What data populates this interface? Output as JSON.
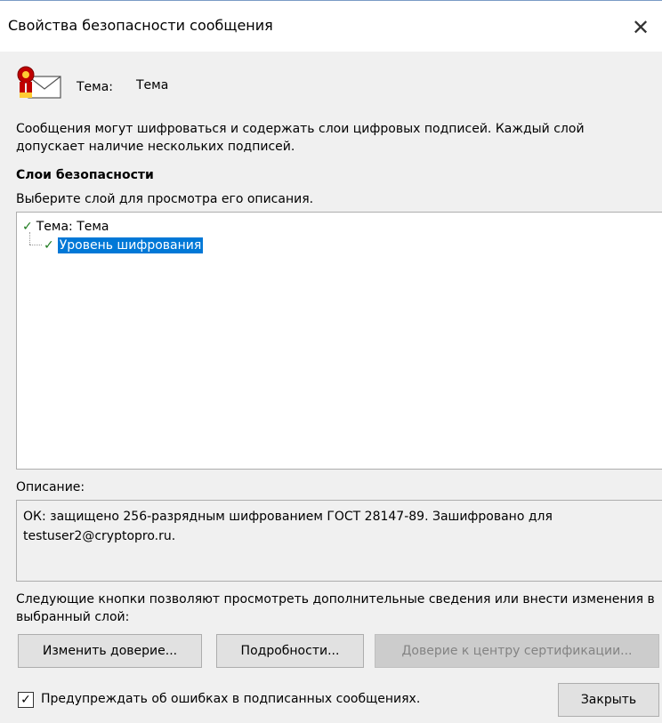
{
  "window": {
    "title": "Свойства безопасности сообщения",
    "close_glyph": "✕"
  },
  "subject": {
    "label": "Тема:",
    "value": "Тема",
    "icon": "certified-mail-icon"
  },
  "intro_text": "Сообщения могут шифроваться и содержать слои цифровых подписей. Каждый слой допускает наличие нескольких подписей.",
  "layers": {
    "heading": "Слои безопасности",
    "hint": "Выберите слой для просмотра его описания.",
    "items": [
      {
        "label": "Тема: Тема",
        "status_icon": "check-icon",
        "selected": false
      },
      {
        "label": "Уровень шифрования",
        "status_icon": "check-icon",
        "selected": true
      }
    ]
  },
  "description": {
    "label": "Описание:",
    "text": "ОК: защищено 256-разрядным шифрованием ГОСТ 28147-89. Зашифровано для testuser2@cryptopro.ru."
  },
  "buttons_hint": "Следующие кнопки позволяют просмотреть дополнительные сведения или внести изменения в выбранный слой:",
  "buttons": {
    "change_trust": "Изменить доверие...",
    "details": "Подробности...",
    "ca_trust": "Доверие к центру сертификации...",
    "close": "Закрыть"
  },
  "warn_checkbox": {
    "label": "Предупреждать об ошибках в подписанных сообщениях.",
    "checked": true
  },
  "colors": {
    "selection": "#0078d7",
    "check": "#1e7b1e",
    "ribbon": "#c00000"
  }
}
